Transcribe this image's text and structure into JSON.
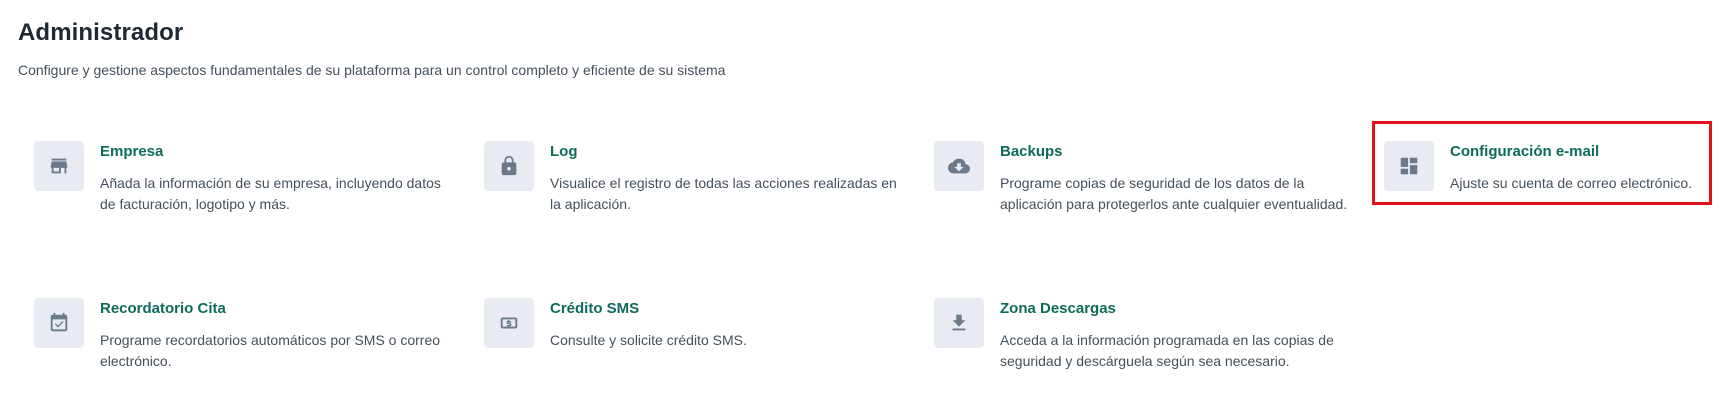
{
  "header": {
    "title": "Administrador",
    "subtitle": "Configure y gestione aspectos fundamentales de su plataforma para un control completo y eficiente de su sistema"
  },
  "cards": [
    {
      "title": "Empresa",
      "description": "Añada la información de su empresa, incluyendo datos de facturación, logotipo y más.",
      "icon": "store-icon"
    },
    {
      "title": "Log",
      "description": "Visualice el registro de todas las acciones realizadas en la aplicación.",
      "icon": "lock-icon"
    },
    {
      "title": "Backups",
      "description": "Programe copias de seguridad de los datos de la aplicación para protegerlos ante cualquier eventualidad.",
      "icon": "cloud-download-icon"
    },
    {
      "title": "Configuración e-mail",
      "description": "Ajuste su cuenta de correo electrónico.",
      "icon": "dashboard-icon"
    },
    {
      "title": "Recordatorio Cita",
      "description": "Programe recordatorios automáticos por SMS o correo electrónico.",
      "icon": "calendar-check-icon"
    },
    {
      "title": "Crédito SMS",
      "description": "Consulte y solicite crédito SMS.",
      "icon": "money-icon"
    },
    {
      "title": "Zona Descargas",
      "description": "Acceda a la información programada en las copias de seguridad y descárguela según sea necesario.",
      "icon": "download-icon"
    }
  ],
  "colors": {
    "title_accent": "#0e6b5a",
    "icon_background": "#e8ebf2",
    "icon_fill": "#6b7a89",
    "highlight_border": "#e0121b"
  }
}
